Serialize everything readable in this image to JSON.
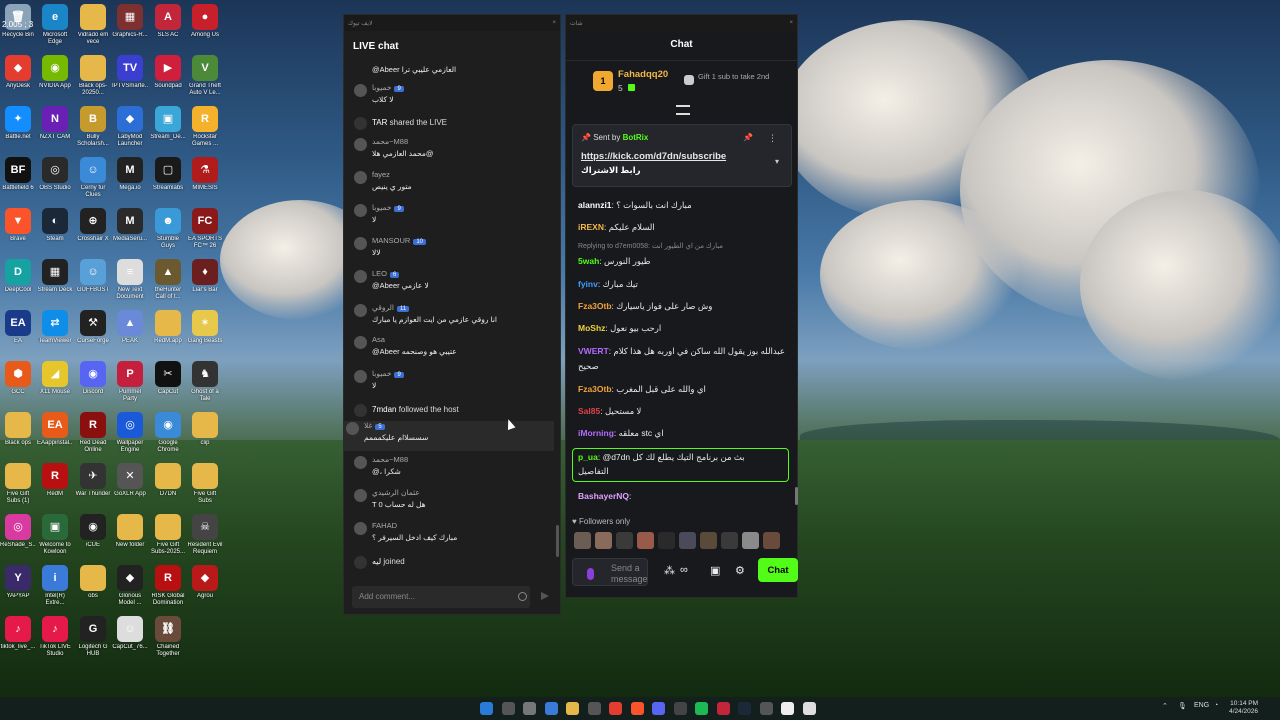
{
  "desktop": {
    "corner_text": "2.005 ; 3",
    "icons": [
      {
        "label": "Recycle Bin",
        "color": "#8aa3b8",
        "glyph": "🗑"
      },
      {
        "label": "Microsoft Edge",
        "color": "#1b86c7",
        "glyph": "e"
      },
      {
        "label": "Vidrado em vece",
        "color": "#e6b84a",
        "glyph": ""
      },
      {
        "label": "Graphics-R...",
        "color": "#7e2f2f",
        "glyph": "▦"
      },
      {
        "label": "SLS AC",
        "color": "#c2263a",
        "glyph": "A"
      },
      {
        "label": "Among Us",
        "color": "#c8202a",
        "glyph": "●"
      },
      {
        "label": "AnyDesk",
        "color": "#e43d30",
        "glyph": "◆"
      },
      {
        "label": "NVIDIA App",
        "color": "#76b900",
        "glyph": "◉"
      },
      {
        "label": "Black ops-20250...",
        "color": "#e6b84a",
        "glyph": ""
      },
      {
        "label": "IPTVSmarte...",
        "color": "#3b3fd0",
        "glyph": "TV"
      },
      {
        "label": "Soundpad",
        "color": "#d01f3c",
        "glyph": "▶"
      },
      {
        "label": "Grand Theft Auto V Le...",
        "color": "#4c8a3a",
        "glyph": "V"
      },
      {
        "label": "Battle.net",
        "color": "#148eff",
        "glyph": "✦"
      },
      {
        "label": "NZXT CAM",
        "color": "#6a1fb5",
        "glyph": "N"
      },
      {
        "label": "Bully Scholarsh...",
        "color": "#c49b2c",
        "glyph": "B"
      },
      {
        "label": "LabyMod Launcher",
        "color": "#2b6fd6",
        "glyph": "◆"
      },
      {
        "label": "Stream_De...",
        "color": "#3aa7d8",
        "glyph": "▣"
      },
      {
        "label": "Rockstar Games ...",
        "color": "#f4b12c",
        "glyph": "R"
      },
      {
        "label": "Battlefield 6",
        "color": "#111111",
        "glyph": "BF"
      },
      {
        "label": "OBS Studio",
        "color": "#2a2a2a",
        "glyph": "◎"
      },
      {
        "label": "Cerny fur Clues",
        "color": "#3b8ad8",
        "glyph": "☺"
      },
      {
        "label": "Mega.io",
        "color": "#222222",
        "glyph": "M"
      },
      {
        "label": "Streamlabs",
        "color": "#1a1a1a",
        "glyph": "▢"
      },
      {
        "label": "MIMESIS",
        "color": "#b01b1b",
        "glyph": "⚗"
      },
      {
        "label": "Brave",
        "color": "#fb542b",
        "glyph": "▼"
      },
      {
        "label": "Steam",
        "color": "#1b2838",
        "glyph": "◐"
      },
      {
        "label": "Crosshair X",
        "color": "#222222",
        "glyph": "⊕"
      },
      {
        "label": "MediaSeru...",
        "color": "#2a2a2a",
        "glyph": "M"
      },
      {
        "label": "Stumble Guys",
        "color": "#3a9ad8",
        "glyph": "☻"
      },
      {
        "label": "EA SPORTS FC™ 26",
        "color": "#8a1a1a",
        "glyph": "FC"
      },
      {
        "label": "DeepCool",
        "color": "#17a2a2",
        "glyph": "D"
      },
      {
        "label": "Stream Deck",
        "color": "#222222",
        "glyph": "▦"
      },
      {
        "label": "GUFFBUST",
        "color": "#5aa0d8",
        "glyph": "☺"
      },
      {
        "label": "New Text Document",
        "color": "#dddddd",
        "glyph": "≡"
      },
      {
        "label": "theHunter Call of t...",
        "color": "#6b5a30",
        "glyph": "▲"
      },
      {
        "label": "Liar's Bar",
        "color": "#6b1f1f",
        "glyph": "♦"
      },
      {
        "label": "EA",
        "color": "#1a3a8a",
        "glyph": "EA"
      },
      {
        "label": "TeamViewer",
        "color": "#0e8ee9",
        "glyph": "⇄"
      },
      {
        "label": "CurseForge",
        "color": "#222222",
        "glyph": "⚒"
      },
      {
        "label": "PEAK",
        "color": "#6a8ad8",
        "glyph": "▲"
      },
      {
        "label": "RedM.app",
        "color": "#e6b84a",
        "glyph": ""
      },
      {
        "label": "Gang Beasts",
        "color": "#e6c84a",
        "glyph": "✶"
      },
      {
        "label": "GCC",
        "color": "#e85a1a",
        "glyph": "⬢"
      },
      {
        "label": "X11 Mouse",
        "color": "#e6c62a",
        "glyph": "◢"
      },
      {
        "label": "Discord",
        "color": "#5865f2",
        "glyph": "◉"
      },
      {
        "label": "Pummel Party",
        "color": "#c41f3c",
        "glyph": "P"
      },
      {
        "label": "CapCut",
        "color": "#111111",
        "glyph": "✂"
      },
      {
        "label": "Ghost of a Tale",
        "color": "#333333",
        "glyph": "♞"
      },
      {
        "label": "Black ops",
        "color": "#e6b84a",
        "glyph": ""
      },
      {
        "label": "EAappinstal...",
        "color": "#e85a1a",
        "glyph": "EA"
      },
      {
        "label": "Red Dead Online",
        "color": "#8a1010",
        "glyph": "R"
      },
      {
        "label": "Wallpaper Engine",
        "color": "#1a5ad8",
        "glyph": "◎"
      },
      {
        "label": "Google Chrome",
        "color": "#3a8ad8",
        "glyph": "◉"
      },
      {
        "label": "clip",
        "color": "#e6b84a",
        "glyph": ""
      },
      {
        "label": "Five Gift Subs (1)",
        "color": "#e6b84a",
        "glyph": ""
      },
      {
        "label": "RedM",
        "color": "#b81010",
        "glyph": "R"
      },
      {
        "label": "War Thunder",
        "color": "#333333",
        "glyph": "✈"
      },
      {
        "label": "GoXLR App",
        "color": "#555555",
        "glyph": "✕"
      },
      {
        "label": "D7DN",
        "color": "#e6b84a",
        "glyph": ""
      },
      {
        "label": "Five Gift Subs",
        "color": "#e6b84a",
        "glyph": ""
      },
      {
        "label": "ReShade_S...",
        "color": "#d83aa0",
        "glyph": "◎"
      },
      {
        "label": "Welcome to Kowloon",
        "color": "#2a6a3a",
        "glyph": "▣"
      },
      {
        "label": "iCUE",
        "color": "#222222",
        "glyph": "◉"
      },
      {
        "label": "New folder",
        "color": "#e6b84a",
        "glyph": ""
      },
      {
        "label": "Five Gift Subs-2025...",
        "color": "#e6b84a",
        "glyph": ""
      },
      {
        "label": "Resident Evil Requiem",
        "color": "#444444",
        "glyph": "☠"
      },
      {
        "label": "YAPYAP",
        "color": "#3a2a6a",
        "glyph": "Y"
      },
      {
        "label": "Intel(R) Extre...",
        "color": "#3a7ad8",
        "glyph": "i"
      },
      {
        "label": "obs",
        "color": "#e6b84a",
        "glyph": ""
      },
      {
        "label": "Glorious Model ...",
        "color": "#222222",
        "glyph": "◆"
      },
      {
        "label": "RISK Global Domination",
        "color": "#b81010",
        "glyph": "R"
      },
      {
        "label": "Agrou",
        "color": "#b81a1a",
        "glyph": "◆"
      },
      {
        "label": "tiktok_live_...",
        "color": "#e61a4a",
        "glyph": "♪"
      },
      {
        "label": "TikTok LIVE Studio",
        "color": "#e61a4a",
        "glyph": "♪"
      },
      {
        "label": "Logitech G HUB",
        "color": "#222222",
        "glyph": "G"
      },
      {
        "label": "CapCut_76...",
        "color": "#dddddd",
        "glyph": "☺"
      },
      {
        "label": "Chained Together",
        "color": "#6a4a3a",
        "glyph": "⛓"
      }
    ]
  },
  "live_window": {
    "bar_title": "لايف تيوك",
    "title": "LIVE chat",
    "comment_placeholder": "Add comment...",
    "rows": [
      {
        "type": "text",
        "text": "@Abeer العازمي عليبي ترا"
      },
      {
        "type": "msg",
        "name": "خميوبا",
        "badge": "9",
        "text": "لا كلاب"
      },
      {
        "type": "system",
        "name": "TAR",
        "text": "shared the LIVE"
      },
      {
        "type": "msg",
        "name": "محمد~M88",
        "badge": "",
        "text": "محمد العازمي هلا@"
      },
      {
        "type": "msg",
        "name": "fayez",
        "badge": "",
        "text": "متور ي ينيص"
      },
      {
        "type": "msg",
        "name": "خميوبا",
        "badge": "9",
        "text": "لا"
      },
      {
        "type": "msg",
        "name": "MANSOUR",
        "badge": "10",
        "text": "لالا"
      },
      {
        "type": "msg",
        "name": "LEO",
        "badge": "6",
        "text": "@Abeer لا عازمي"
      },
      {
        "type": "msg",
        "name": "الروقي",
        "badge": "11",
        "text": "انا روقي عازمي من ايت العوازم يا مبارك"
      },
      {
        "type": "msg",
        "name": "Asa",
        "badge": "",
        "text": "@Abeer عتيبي هو وصنحمه"
      },
      {
        "type": "msg",
        "name": "خميوبا",
        "badge": "9",
        "text": "لا"
      },
      {
        "type": "system",
        "name": "7mdan",
        "text": "followed the host"
      },
      {
        "type": "msg",
        "name": "غلا",
        "badge": "5",
        "text": "سسسلاام عليكمممم"
      },
      {
        "type": "msg",
        "name": "محمد~M88",
        "badge": "",
        "text": "@، شكرا"
      },
      {
        "type": "msg",
        "name": "عثمان الرشيدي",
        "badge": "",
        "text": "T 0 هل له حساب"
      },
      {
        "type": "msg",
        "name": "FAHAD",
        "badge": "",
        "text": "مبارك كيف ادخل السيرفر ؟"
      },
      {
        "type": "system",
        "name": "ليه",
        "text": "joined"
      }
    ]
  },
  "kick_window": {
    "bar_title": "شات",
    "title": "Chat",
    "leader": {
      "rank": "1",
      "name": "Fahadqq20",
      "count": "5",
      "gift_text": "Gift 1 sub to take 2nd"
    },
    "pinned": {
      "sent_by": "Sent by",
      "bot": "BotRix",
      "link": "https://kick.com/d7dn/subscribe",
      "subtitle": "رابط الاشتراك"
    },
    "messages": [
      {
        "user": "alannzi1",
        "color": "#ffffff",
        "text": "مبارك انت بالسوات ؟"
      },
      {
        "user": "iREXN",
        "color": "#f2b84b",
        "text": "السلام عليكم"
      },
      {
        "reply": "Replying to d7em0058: مبارك من اي الطيور انت"
      },
      {
        "user": "5wah",
        "color": "#53fc18",
        "text": "طيور النورس"
      },
      {
        "user": "fyinv",
        "color": "#3aa0ff",
        "text": "تيك مبارك"
      },
      {
        "user": "Fza3Otb",
        "color": "#f2a23b",
        "text": "وش صار على فواز ياسيارك"
      },
      {
        "user": "MoShz",
        "color": "#f2d23b",
        "text": "ارحب بيو نعول"
      },
      {
        "user": "VWERT",
        "color": "#b36bff",
        "text": "عبدالله بوز يقول الله ساكن في اوربه هل هذا كلام"
      },
      {
        "user": "",
        "color": "#ffffff",
        "text": "صحيح"
      },
      {
        "user": "Fza3Otb",
        "color": "#f2a23b",
        "text": "اي والله على قبل المغرب"
      },
      {
        "user": "Sal85",
        "color": "#e0414b",
        "text": "لا مستحيل"
      },
      {
        "user": "iMorning",
        "color": "#b36bff",
        "text": "معلقه stc اي"
      },
      {
        "user": "p_ua",
        "color": "#53fc18",
        "text": "@d7dn بث من برنامج التيك يطلع لك كل"
      },
      {
        "user": "",
        "color": "#ffffff",
        "text": "التفاصيل"
      },
      {
        "user": "BashayerNQ",
        "color": "#e0a0ff",
        "text": ""
      }
    ],
    "followers_only": "Followers only",
    "send_placeholder": "Send a message",
    "chat_button": "Chat"
  },
  "taskbar": {
    "lang": "ENG",
    "time": "10:14 PM",
    "date": "4/24/2026"
  }
}
